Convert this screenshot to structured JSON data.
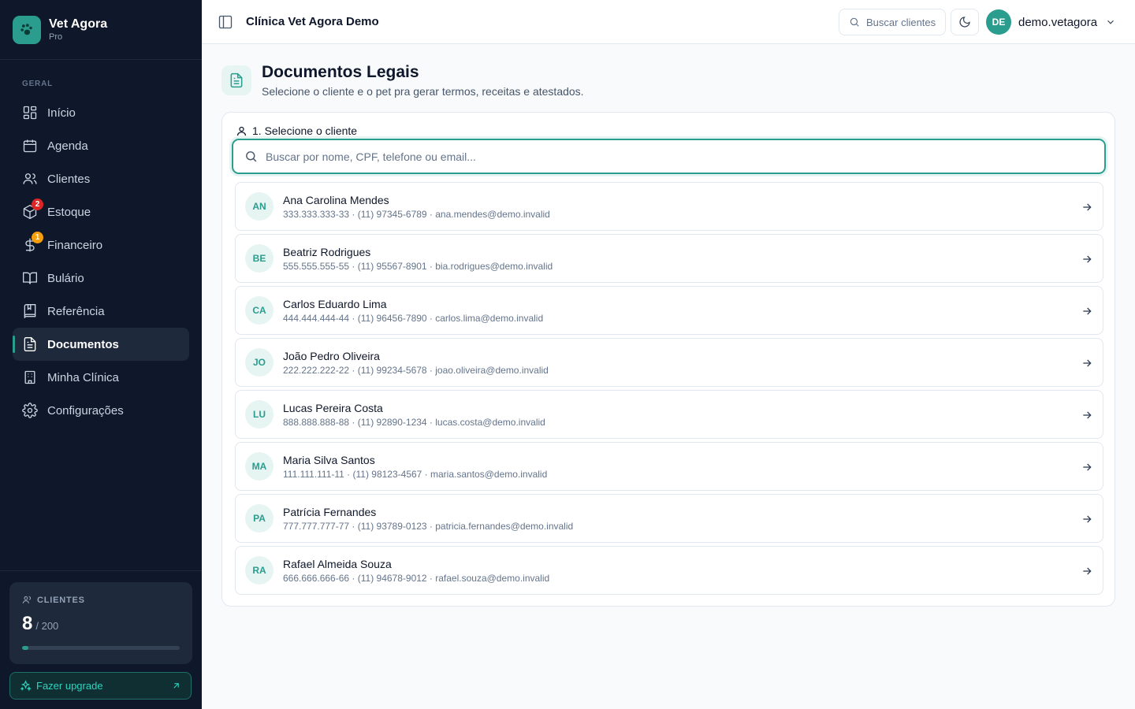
{
  "brand": {
    "name": "Vet Agora",
    "plan": "Pro"
  },
  "sidebar": {
    "section": "GERAL",
    "items": [
      {
        "label": "Início",
        "icon": "grid-icon"
      },
      {
        "label": "Agenda",
        "icon": "calendar-icon"
      },
      {
        "label": "Clientes",
        "icon": "users-icon"
      },
      {
        "label": "Estoque",
        "icon": "package-icon",
        "badge": "2"
      },
      {
        "label": "Financeiro",
        "icon": "dollar-icon",
        "badge": "1"
      },
      {
        "label": "Bulário",
        "icon": "book-open-icon"
      },
      {
        "label": "Referência",
        "icon": "book-icon"
      },
      {
        "label": "Documentos",
        "icon": "file-text-icon",
        "active": true
      },
      {
        "label": "Minha Clínica",
        "icon": "building-icon"
      },
      {
        "label": "Configurações",
        "icon": "gear-icon"
      }
    ],
    "usage": {
      "label": "CLIENTES",
      "count": "8",
      "max": "/ 200",
      "fraction": 0.04
    },
    "upgrade_label": "Fazer upgrade"
  },
  "topbar": {
    "clinic": "Clínica Vet Agora Demo",
    "search_placeholder": "Buscar clientes",
    "user_initials": "DE",
    "user_name": "demo.vetagora"
  },
  "page": {
    "title": "Documentos Legais",
    "subtitle": "Selecione o cliente e o pet pra gerar termos, receitas e atestados.",
    "step_label": "1. Selecione o cliente",
    "search_placeholder": "Buscar por nome, CPF, telefone ou email..."
  },
  "clients": [
    {
      "initials": "AN",
      "name": "Ana Carolina Mendes",
      "meta": "333.333.333-33 · (11) 97345-6789 · ana.mendes@demo.invalid"
    },
    {
      "initials": "BE",
      "name": "Beatriz Rodrigues",
      "meta": "555.555.555-55 · (11) 95567-8901 · bia.rodrigues@demo.invalid"
    },
    {
      "initials": "CA",
      "name": "Carlos Eduardo Lima",
      "meta": "444.444.444-44 · (11) 96456-7890 · carlos.lima@demo.invalid"
    },
    {
      "initials": "JO",
      "name": "João Pedro Oliveira",
      "meta": "222.222.222-22 · (11) 99234-5678 · joao.oliveira@demo.invalid"
    },
    {
      "initials": "LU",
      "name": "Lucas Pereira Costa",
      "meta": "888.888.888-88 · (11) 92890-1234 · lucas.costa@demo.invalid"
    },
    {
      "initials": "MA",
      "name": "Maria Silva Santos",
      "meta": "111.111.111-11 · (11) 98123-4567 · maria.santos@demo.invalid"
    },
    {
      "initials": "PA",
      "name": "Patrícia Fernandes",
      "meta": "777.777.777-77 · (11) 93789-0123 · patricia.fernandes@demo.invalid"
    },
    {
      "initials": "RA",
      "name": "Rafael Almeida Souza",
      "meta": "666.666.666-66 · (11) 94678-9012 · rafael.souza@demo.invalid"
    }
  ],
  "colors": {
    "accent": "#2a9d8f",
    "sidebar_bg": "#0f172a",
    "badge_red": "#dc2626",
    "badge_amber": "#f59e0b"
  }
}
